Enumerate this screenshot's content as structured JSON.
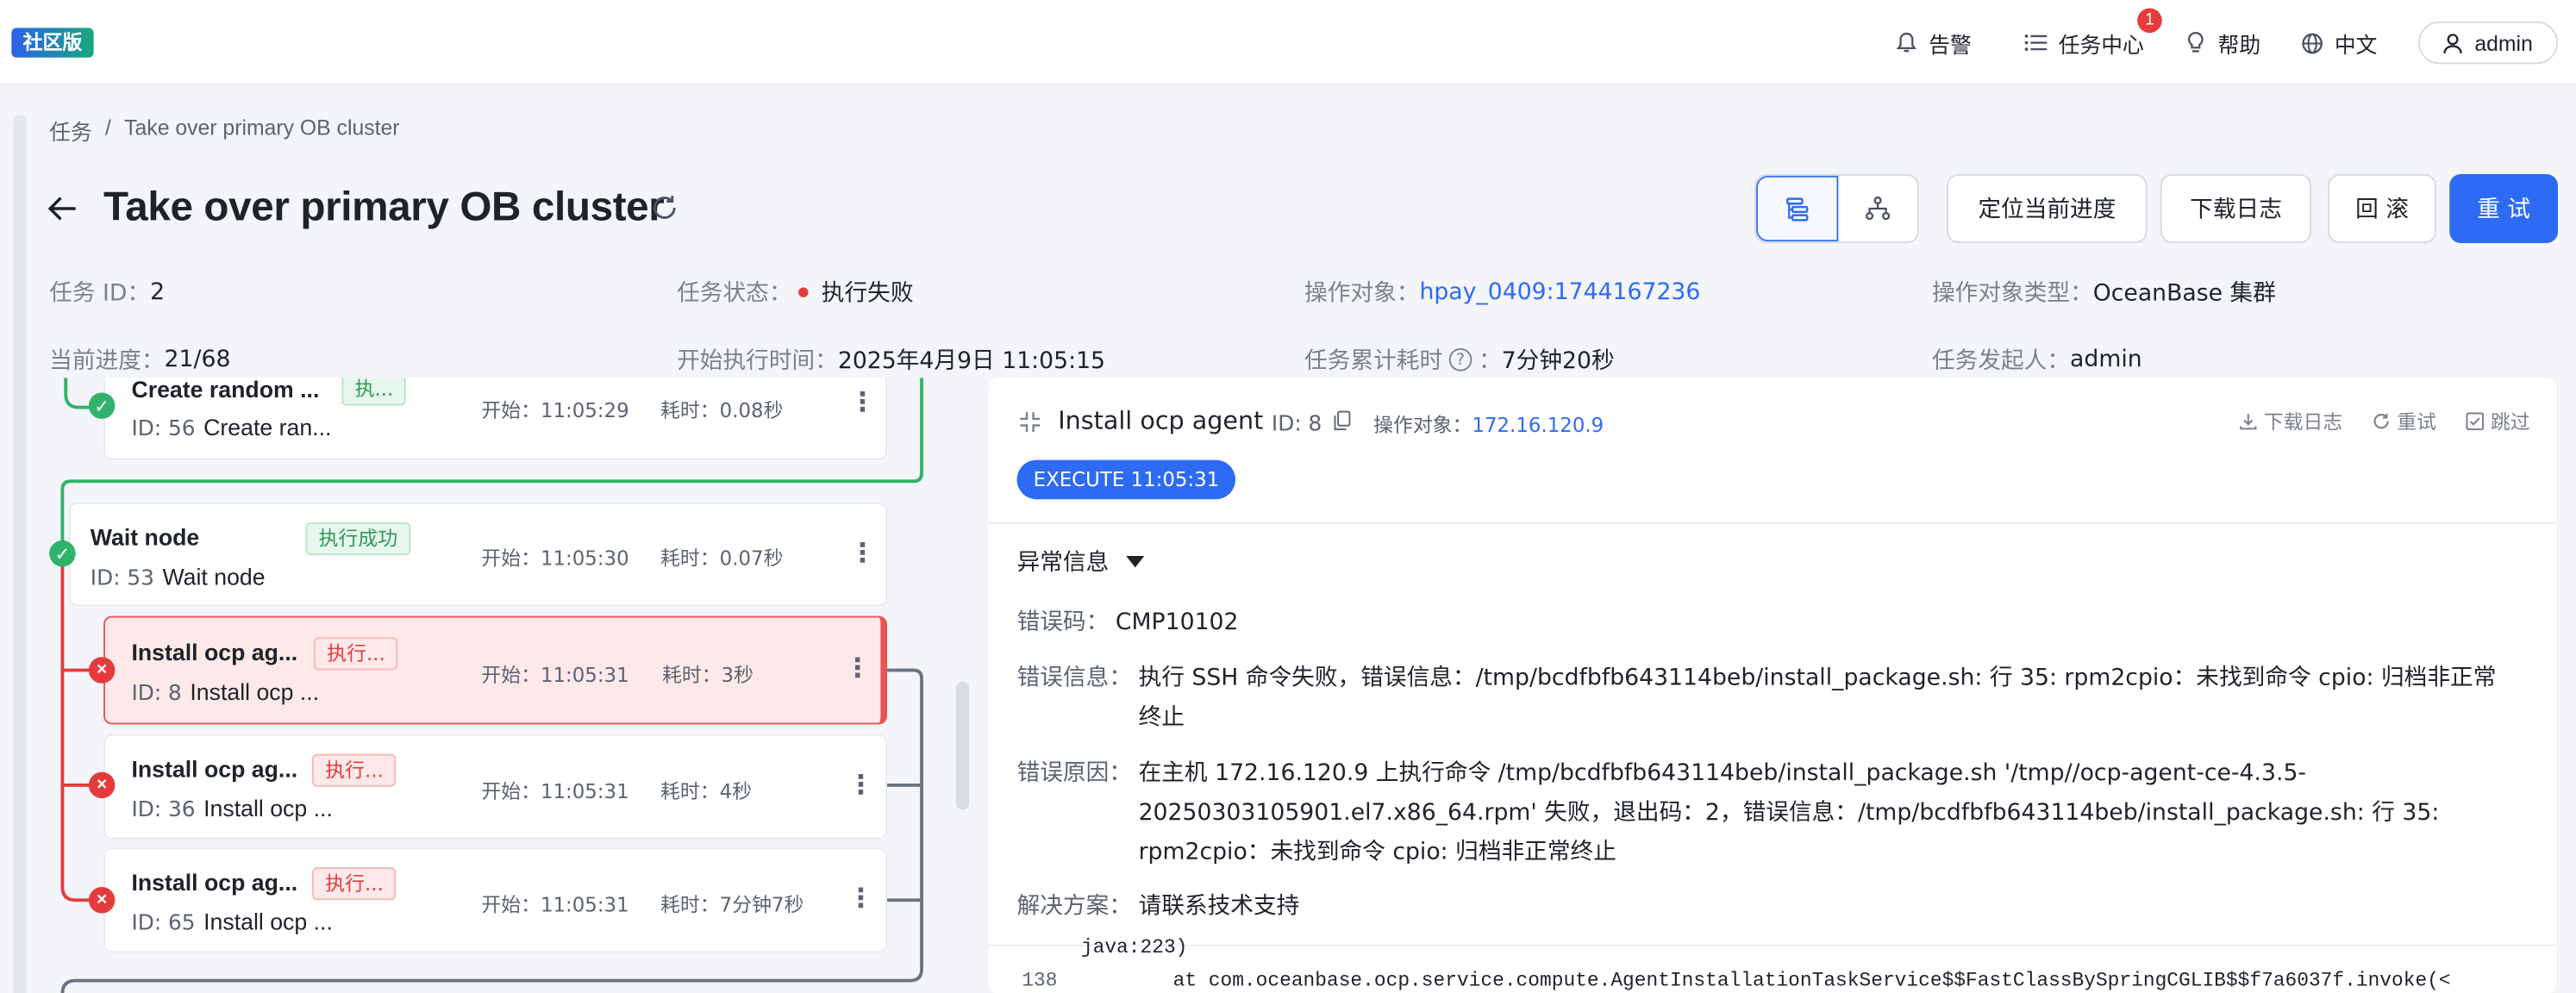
{
  "topbar": {
    "edition_badge": "社区版",
    "alerts_label": "告警",
    "tasks_label": "任务中心",
    "tasks_badge": "1",
    "help_label": "帮助",
    "lang_label": "中文",
    "user_label": "admin"
  },
  "breadcrumb": {
    "root": "任务",
    "sep": "/",
    "current": "Take over primary OB cluster"
  },
  "header": {
    "title": "Take over primary OB cluster",
    "btn_locate": "定位当前进度",
    "btn_download": "下载日志",
    "btn_rollback": "回 滚",
    "btn_retry": "重 试"
  },
  "info": {
    "task_id_k": "任务 ID：",
    "task_id_v": "2",
    "status_k": "任务状态：",
    "status_v": "执行失败",
    "target_k": "操作对象：",
    "target_v": "hpay_0409:1744167236",
    "target_type_k": "操作对象类型：",
    "target_type_v": "OceanBase 集群",
    "progress_k": "当前进度：",
    "progress_v": "21/68",
    "start_k": "开始执行时间：",
    "start_v": "2025年4月9日 11:05:15",
    "elapsed_k": "任务累计耗时",
    "elapsed_v": "7分钟20秒",
    "initiator_k": "任务发起人：",
    "initiator_v": "admin"
  },
  "nodes": [
    {
      "title": "Create random ...",
      "tag": "执...",
      "id": "ID: 56",
      "name": "Create ran...",
      "start": "开始：11:05:29",
      "cost": "耗时：0.08秒"
    },
    {
      "title": "Wait node",
      "tag": "执行成功",
      "id": "ID: 53",
      "name": "Wait node",
      "start": "开始：11:05:30",
      "cost": "耗时：0.07秒"
    },
    {
      "title": "Install ocp ag...",
      "tag": "执行...",
      "id": "ID: 8",
      "name": "Install ocp ...",
      "start": "开始：11:05:31",
      "cost": "耗时：3秒"
    },
    {
      "title": "Install ocp ag...",
      "tag": "执行...",
      "id": "ID: 36",
      "name": "Install ocp ...",
      "start": "开始：11:05:31",
      "cost": "耗时：4秒"
    },
    {
      "title": "Install ocp ag...",
      "tag": "执行...",
      "id": "ID: 65",
      "name": "Install ocp ...",
      "start": "开始：11:05:31",
      "cost": "耗时：7分钟7秒"
    }
  ],
  "detail": {
    "title": "Install ocp agent",
    "id": "ID: 8",
    "target_k": "操作对象：",
    "target_v": "172.16.120.9",
    "act_download": "下载日志",
    "act_retry": "重试",
    "act_skip": "跳过",
    "exec_pill": "EXECUTE 11:05:31",
    "section": "异常信息",
    "code_k": "错误码：",
    "code_v": "CMP10102",
    "msg_k": "错误信息：",
    "msg_v": "执行 SSH 命令失败，错误信息：/tmp/bcdfbfb643114beb/install_package.sh: 行 35: rpm2cpio：未找到命令 cpio: 归档非正常终止",
    "cause_k": "错误原因：",
    "cause_v": "在主机 172.16.120.9 上执行命令 /tmp/bcdfbfb643114beb/install_package.sh '/tmp//ocp-agent-ce-4.3.5-20250303105901.el7.x86_64.rpm' 失败，退出码：2，错误信息：/tmp/bcdfbfb643114beb/install_package.sh: 行 35: rpm2cpio：未找到命令 cpio: 归档非正常终止",
    "solution_k": "解决方案：",
    "solution_v": "请联系技术支持",
    "log_prev": "java:223)",
    "log_line_no": "138",
    "log_line": "at com.oceanbase.ocp.service.compute.AgentInstallationTaskService$$FastClassBySpringCGLIB$$f7a6037f.invoke(<"
  }
}
